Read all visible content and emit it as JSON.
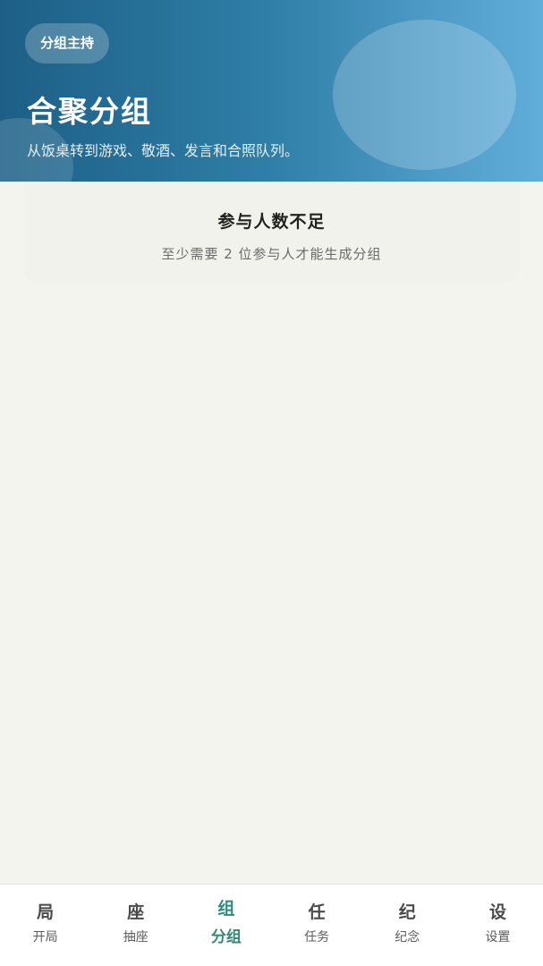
{
  "header": {
    "pill_label": "分组主持",
    "title": "合聚分组",
    "subtitle": "从饭桌转到游戏、敬酒、发言和合照队列。"
  },
  "notice": {
    "title": "参与人数不足",
    "description": "至少需要 2 位参与人才能生成分组"
  },
  "tabbar": {
    "active_index": 2,
    "items": [
      {
        "glyph": "局",
        "label": "开局"
      },
      {
        "glyph": "座",
        "label": "抽座"
      },
      {
        "glyph": "组",
        "label": "分组"
      },
      {
        "glyph": "任",
        "label": "任务"
      },
      {
        "glyph": "纪",
        "label": "纪念"
      },
      {
        "glyph": "设",
        "label": "设置"
      }
    ]
  },
  "colors": {
    "header_gradient_start": "#1d5f86",
    "header_gradient_end": "#62aedb",
    "accent": "#2f8a7a",
    "background": "#f4f4ef"
  }
}
